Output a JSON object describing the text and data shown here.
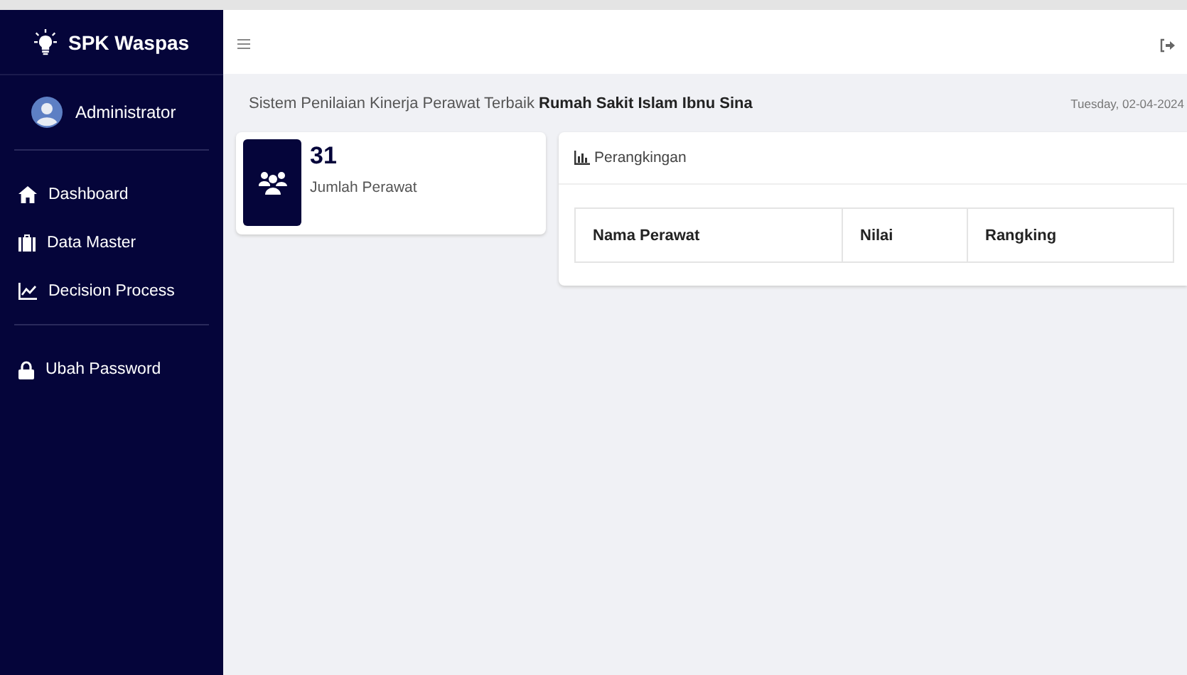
{
  "brand": {
    "title": "SPK Waspas"
  },
  "user": {
    "name": "Administrator"
  },
  "menu": [
    [
      {
        "label": "Dashboard",
        "kind": "home"
      },
      {
        "label": "Data Master",
        "kind": "case"
      },
      {
        "label": "Decision Process",
        "kind": "chart"
      }
    ],
    [
      {
        "label": "Ubah Password",
        "kind": "lock"
      }
    ]
  ],
  "subtitle": "Sistem Penilaian Kinerja Perawat Terbaik **Rumah Sakit Islam Ibnu Sina**",
  "date": "Tuesday, 02-04-2024",
  "stat": {
    "value": "31",
    "label": "Jumlah Perawat"
  },
  "ranking": {
    "title": "Perangkingan",
    "columns": [
      "Nama Perawat",
      "Nilai",
      "Rangking"
    ]
  }
}
